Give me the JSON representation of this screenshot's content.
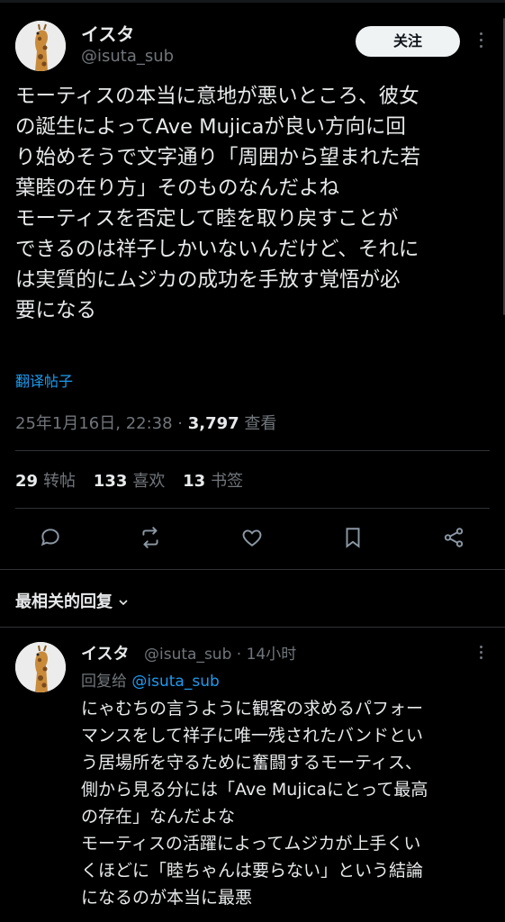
{
  "post": {
    "author_name": "イスタ",
    "author_handle": "@isuta_sub",
    "follow_label": "关注",
    "text_lines": [
      "モーティスの本当に意地が悪いところ、彼女",
      "の誕生によってAve Mujicaが良い方向に回",
      "り始めそうで文字通り「周囲から望まれた若",
      "葉睦の在り方」そのものなんだよね",
      "モーティスを否定して睦を取り戻すことが",
      "できるのは祥子しかいないんだけど、それに",
      "は実質的にムジカの成功を手放す覚悟が必",
      "要になる"
    ],
    "translate_label": "翻译帖子",
    "timestamp": "25年1月16日, 22:38 · ",
    "views": "3,797",
    "views_label": " 查看",
    "reposts": "29",
    "reposts_label": "转帖",
    "likes": "133",
    "likes_label": "喜欢",
    "bookmarks": "13",
    "bookmarks_label": "书签"
  },
  "actions": {
    "reply_icon": "reply-icon",
    "repost_icon": "repost-icon",
    "like_icon": "heart-icon",
    "bookmark_icon": "bookmark-icon",
    "share_icon": "share-icon"
  },
  "replies_sort": {
    "label": "最相关的回复"
  },
  "reply": {
    "author_name": "イスタ",
    "meta": "@isuta_sub · 14小时",
    "replying_to_label": "回复给 ",
    "replying_to_handle": "@isuta_sub",
    "text_lines": [
      "にゃむちの言うように観客の求めるパフォー",
      "マンスをして祥子に唯一残されたバンドとい",
      "う居場所を守るために奮闘するモーティス、",
      "側から見る分には「Ave Mujicaにとって最高",
      "の存在」なんだよな",
      "モーティスの活躍によってムジカが上手くい",
      "くほどに「睦ちゃんは要らない」という結論",
      "になるのが本当に最悪"
    ]
  },
  "colors": {
    "background": "#000000",
    "text": "#e7e9ea",
    "secondary": "#71767b",
    "link": "#1d9bf0",
    "divider": "#2f3336"
  }
}
